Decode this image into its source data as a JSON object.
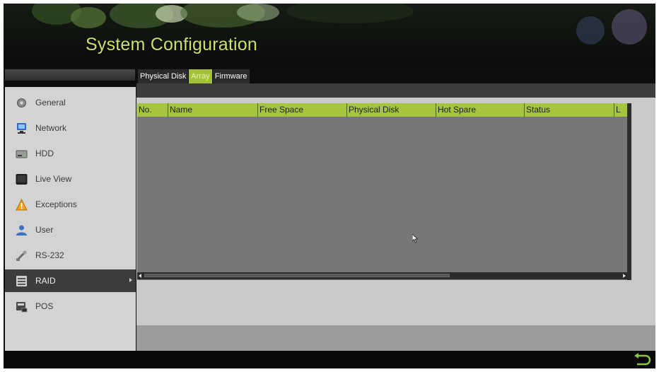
{
  "header": {
    "title": "System Configuration"
  },
  "tabs": [
    {
      "label": "Physical Disk",
      "active": false
    },
    {
      "label": "Array",
      "active": true
    },
    {
      "label": "Firmware",
      "active": false
    }
  ],
  "sidebar": {
    "items": [
      {
        "label": "General",
        "icon": "gear-icon",
        "active": false
      },
      {
        "label": "Network",
        "icon": "network-icon",
        "active": false
      },
      {
        "label": "HDD",
        "icon": "hdd-icon",
        "active": false
      },
      {
        "label": "Live View",
        "icon": "monitor-icon",
        "active": false
      },
      {
        "label": "Exceptions",
        "icon": "warning-icon",
        "active": false
      },
      {
        "label": "User",
        "icon": "user-icon",
        "active": false
      },
      {
        "label": "RS-232",
        "icon": "serial-port-icon",
        "active": false
      },
      {
        "label": "RAID",
        "icon": "raid-icon",
        "active": true
      },
      {
        "label": "POS",
        "icon": "pos-icon",
        "active": false
      }
    ]
  },
  "table": {
    "columns": [
      "No.",
      "Name",
      "Free Space",
      "Physical Disk",
      "Hot Spare",
      "Status",
      "L"
    ],
    "rows": []
  },
  "colors": {
    "accent": "#a5c43f",
    "title": "#cfe06a",
    "background": "#0e0e0e"
  },
  "footer": {
    "back_icon": "return-icon"
  }
}
